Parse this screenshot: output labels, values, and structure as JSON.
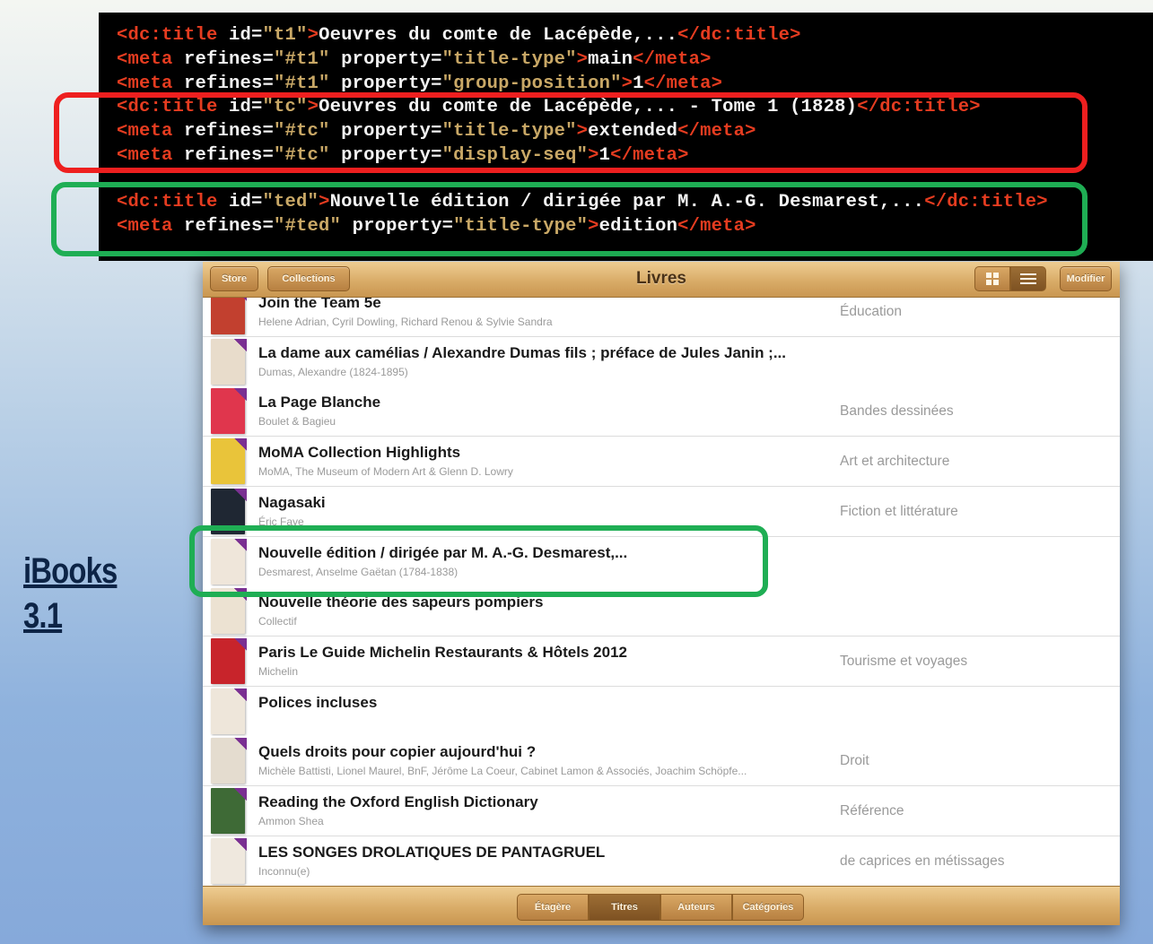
{
  "code": {
    "lines": [
      [
        {
          "t": "<dc:title ",
          "c": "c-tag"
        },
        {
          "t": "id=",
          "c": "c-attr"
        },
        {
          "t": "\"t1\"",
          "c": "c-val"
        },
        {
          "t": ">",
          "c": "c-tag"
        },
        {
          "t": "Oeuvres du comte de Lacépède,...",
          "c": ""
        },
        {
          "t": "</dc:title>",
          "c": "c-tag"
        }
      ],
      [
        {
          "t": "<meta ",
          "c": "c-tag"
        },
        {
          "t": "refines=",
          "c": "c-attr"
        },
        {
          "t": "\"#t1\"",
          "c": "c-val"
        },
        {
          "t": " property=",
          "c": "c-attr"
        },
        {
          "t": "\"title-type\"",
          "c": "c-val"
        },
        {
          "t": ">",
          "c": "c-tag"
        },
        {
          "t": "main",
          "c": ""
        },
        {
          "t": "</meta>",
          "c": "c-tag"
        }
      ],
      [
        {
          "t": "<meta ",
          "c": "c-tag"
        },
        {
          "t": "refines=",
          "c": "c-attr"
        },
        {
          "t": "\"#t1\"",
          "c": "c-val"
        },
        {
          "t": " property=",
          "c": "c-attr"
        },
        {
          "t": "\"group-position\"",
          "c": "c-val"
        },
        {
          "t": ">",
          "c": "c-tag"
        },
        {
          "t": "1",
          "c": ""
        },
        {
          "t": "</meta>",
          "c": "c-tag"
        }
      ],
      [
        {
          "t": "<dc:title ",
          "c": "c-tag"
        },
        {
          "t": "id=",
          "c": "c-attr"
        },
        {
          "t": "\"tc\"",
          "c": "c-val"
        },
        {
          "t": ">",
          "c": "c-tag"
        },
        {
          "t": "Oeuvres du comte de Lacépède,... - Tome 1 (1828)",
          "c": ""
        },
        {
          "t": "</dc:title>",
          "c": "c-tag"
        }
      ],
      [
        {
          "t": "<meta ",
          "c": "c-tag"
        },
        {
          "t": "refines=",
          "c": "c-attr"
        },
        {
          "t": "\"#tc\"",
          "c": "c-val"
        },
        {
          "t": " property=",
          "c": "c-attr"
        },
        {
          "t": "\"title-type\"",
          "c": "c-val"
        },
        {
          "t": ">",
          "c": "c-tag"
        },
        {
          "t": "extended",
          "c": ""
        },
        {
          "t": "</meta>",
          "c": "c-tag"
        }
      ],
      [
        {
          "t": "<meta ",
          "c": "c-tag"
        },
        {
          "t": "refines=",
          "c": "c-attr"
        },
        {
          "t": "\"#tc\"",
          "c": "c-val"
        },
        {
          "t": " property=",
          "c": "c-attr"
        },
        {
          "t": "\"display-seq\"",
          "c": "c-val"
        },
        {
          "t": ">",
          "c": "c-tag"
        },
        {
          "t": "1",
          "c": ""
        },
        {
          "t": "</meta>",
          "c": "c-tag"
        }
      ],
      [
        {
          "t": "<dc:title ",
          "c": "c-tag"
        },
        {
          "t": "id=",
          "c": "c-attr"
        },
        {
          "t": "\"ted\"",
          "c": "c-val"
        },
        {
          "t": ">",
          "c": "c-tag"
        },
        {
          "t": "Nouvelle édition / dirigée par M. A.-G. Desmarest,...",
          "c": ""
        },
        {
          "t": "</dc:title>",
          "c": "c-tag"
        }
      ],
      [
        {
          "t": "<meta ",
          "c": "c-tag"
        },
        {
          "t": "refines=",
          "c": "c-attr"
        },
        {
          "t": "\"#ted\"",
          "c": "c-val"
        },
        {
          "t": " property=",
          "c": "c-attr"
        },
        {
          "t": "\"title-type\"",
          "c": "c-val"
        },
        {
          "t": ">",
          "c": "c-tag"
        },
        {
          "t": "edition",
          "c": ""
        },
        {
          "t": "</meta>",
          "c": "c-tag"
        }
      ]
    ]
  },
  "side_label": {
    "line1": "iBooks",
    "line2": "3.1"
  },
  "toolbar": {
    "store_label": "Store",
    "collections_label": "Collections",
    "title": "Livres",
    "edit_label": "Modifier"
  },
  "books": [
    {
      "title": "Join the Team 5e",
      "author": "Helene Adrian, Cyril Dowling, Richard Renou & Sylvie Sandra",
      "category": "Éducation",
      "cover": "#c2402f"
    },
    {
      "title": "La dame aux camélias / Alexandre Dumas fils ; préface de Jules Janin ;...",
      "author": "Dumas, Alexandre (1824-1895)",
      "category": "",
      "cover": "#e8dccb"
    },
    {
      "title": "La Page Blanche",
      "author": "Boulet & Bagieu",
      "category": "Bandes dessinées",
      "cover": "#e0364d"
    },
    {
      "title": "MoMA Collection Highlights",
      "author": "MoMA, The Museum of Modern Art & Glenn D. Lowry",
      "category": "Art et architecture",
      "cover": "#e9c43a"
    },
    {
      "title": "Nagasaki",
      "author": "Éric Faye",
      "category": "Fiction et littérature",
      "cover": "#1f2733"
    },
    {
      "title": "Nouvelle édition / dirigée par M. A.-G. Desmarest,...",
      "author": "Desmarest, Anselme Gaëtan (1784-1838)",
      "category": "",
      "cover": "#efe6da"
    },
    {
      "title": "Nouvelle théorie des sapeurs pompiers",
      "author": "Collectif",
      "category": "",
      "cover": "#ece2d2"
    },
    {
      "title": "Paris Le Guide Michelin Restaurants & Hôtels 2012",
      "author": "Michelin",
      "category": "Tourisme et voyages",
      "cover": "#c8242b"
    },
    {
      "title": "Polices incluses",
      "author": "",
      "category": "",
      "cover": "#eee6da"
    },
    {
      "title": "Quels droits pour copier aujourd'hui ?",
      "author": "Michèle Battisti, Lionel Maurel, BnF, Jérôme La Coeur, Cabinet Lamon & Associés, Joachim Schöpfe...",
      "category": "Droit",
      "cover": "#e4dccf"
    },
    {
      "title": "Reading the Oxford English Dictionary",
      "author": "Ammon Shea",
      "category": "Référence",
      "cover": "#3e6a36"
    },
    {
      "title": "LES SONGES DROLATIQUES DE PANTAGRUEL",
      "author": "Inconnu(e)",
      "category": "de caprices en métissages",
      "cover": "#efe8de"
    }
  ],
  "bottom_tabs": [
    {
      "label": "Étagère",
      "active": false
    },
    {
      "label": "Titres",
      "active": true
    },
    {
      "label": "Auteurs",
      "active": false
    },
    {
      "label": "Catégories",
      "active": false
    }
  ]
}
